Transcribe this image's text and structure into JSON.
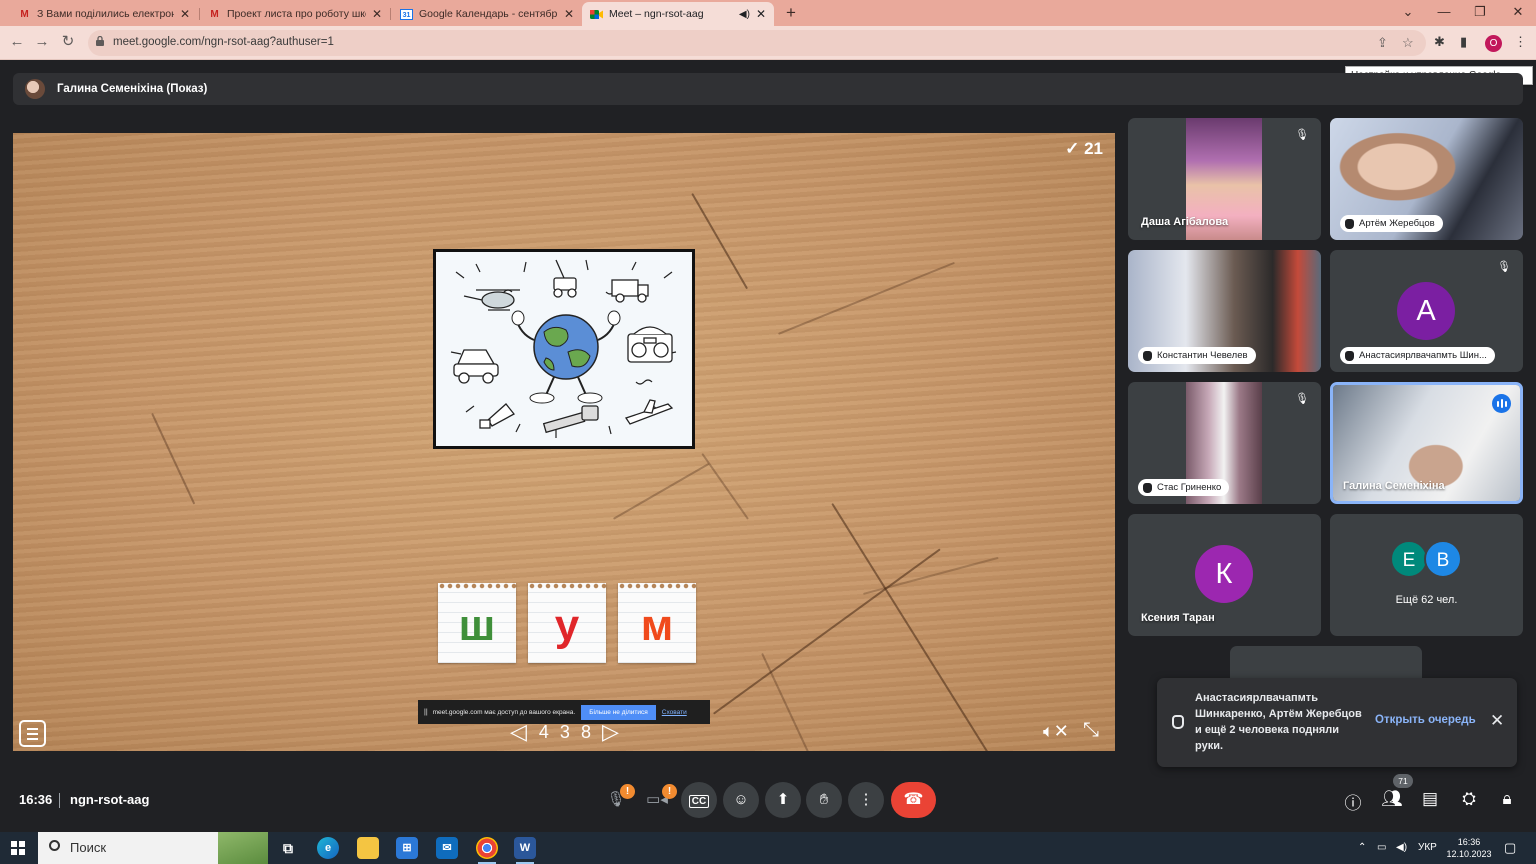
{
  "browser": {
    "tabs": [
      {
        "title": "З Вами поділились електронною",
        "icon": "gmail-icon"
      },
      {
        "title": "Проект листа про роботу школи",
        "icon": "gmail-icon"
      },
      {
        "title": "Google Календарь - сентябрь 2",
        "icon": "calendar-icon"
      },
      {
        "title": "Meet – ngn-rsot-aag",
        "icon": "meet-icon"
      }
    ],
    "url": "meet.google.com/ngn-rsot-aag?authuser=1",
    "profile_initial": "O",
    "tooltip": "Настройка и управление Google Chrome"
  },
  "presenter": {
    "label": "Галина Семеніхіна (Показ)"
  },
  "shared_screen": {
    "score": "21",
    "letters": [
      {
        "char": "ш",
        "color": "#3f8f3a"
      },
      {
        "char": "у",
        "color": "#e0262a"
      },
      {
        "char": "м",
        "color": "#f04a1c"
      }
    ],
    "page_number": "4 3 8",
    "share_banner": {
      "message": "meet.google.com має доступ до вашого екрана.",
      "stop_label": "Більше не ділитися",
      "hide_label": "Сховати"
    }
  },
  "participants": [
    {
      "name": "Даша Агібалова",
      "muted": true
    },
    {
      "name": "Артём Жеребцов",
      "hand_raised": true
    },
    {
      "name": "Константин Чевелев",
      "hand_raised": true
    },
    {
      "name": "Анастасиярлвачапмть Шин...",
      "hand_raised": true,
      "avatar_letter": "А",
      "avatar_color": "#7b1fa2",
      "muted": true
    },
    {
      "name": "Стас Гриненко",
      "hand_raised": true,
      "muted": true
    },
    {
      "name": "Галина Семеніхіна",
      "speaking": true
    },
    {
      "name": "Ксения Таран",
      "avatar_letter": "К",
      "avatar_color": "#9c27b0"
    },
    {
      "more_label": "Ещё 62 чел.",
      "avatars": [
        {
          "letter": "Е",
          "color": "#00897b"
        },
        {
          "letter": "В",
          "color": "#1e88e5"
        }
      ]
    }
  ],
  "notification": {
    "text": "Анастасиярлвачапмть Шинкаренко, Артём Жеребцов и ещё 2 человека подняли руки.",
    "action": "Открыть очередь"
  },
  "meeting": {
    "time": "16:36",
    "code": "ngn-rsot-aag",
    "participant_count": "71",
    "warn_mark": "!"
  },
  "taskbar": {
    "search_label": "Поиск",
    "language": "УКР",
    "time": "16:36",
    "date": "12.10.2023"
  },
  "colors": {
    "accent": "#8ab4f8",
    "end_call": "#ea4335",
    "warning": "#f28b30"
  }
}
